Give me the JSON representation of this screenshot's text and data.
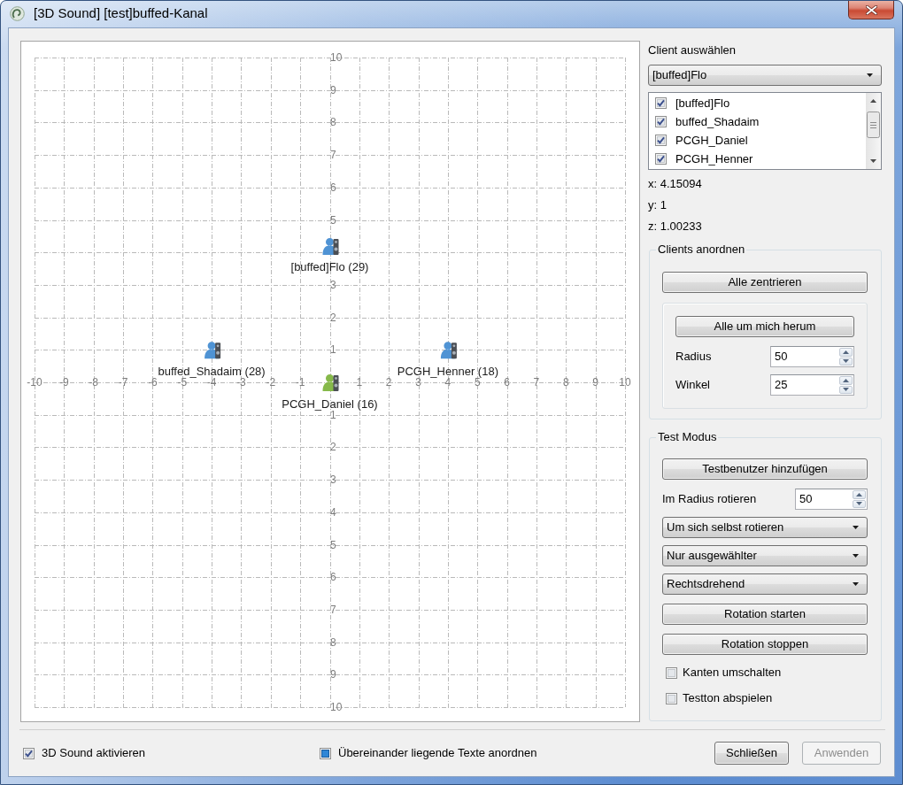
{
  "window": {
    "title": "[3D Sound] [test]buffed-Kanal"
  },
  "canvas": {
    "chart_data": {
      "type": "scatter",
      "grid": true,
      "xlim": [
        -10,
        10
      ],
      "ylim": [
        -10,
        10
      ],
      "xticks": [
        -10,
        -9,
        -8,
        -7,
        -6,
        -5,
        -4,
        -3,
        -2,
        -1,
        1,
        2,
        3,
        4,
        5,
        6,
        7,
        8,
        9,
        10
      ],
      "yticks": [
        10,
        9,
        8,
        7,
        6,
        5,
        3,
        2,
        1,
        {
          "value": -1,
          "label": "1"
        },
        {
          "value": -2,
          "label": "2"
        },
        {
          "value": -3,
          "label": "3"
        },
        {
          "value": -4,
          "label": "4"
        },
        {
          "value": -5,
          "label": "5"
        },
        {
          "value": -6,
          "label": "6"
        },
        {
          "value": -7,
          "label": "7"
        },
        {
          "value": -8,
          "label": "8"
        },
        {
          "value": -9,
          "label": "9"
        },
        {
          "value": -10,
          "label": "10"
        }
      ],
      "x": [
        -4,
        0,
        4
      ],
      "series": [
        {
          "name": "[buffed]Flo (29)",
          "color": "#4f93d4",
          "values": [
            null,
            4.2,
            null
          ]
        },
        {
          "name": "buffed_Shadaim (28)",
          "color": "#4f93d4",
          "values": [
            1,
            null,
            null
          ]
        },
        {
          "name": "PCGH_Henner (18)",
          "color": "#4f93d4",
          "values": [
            null,
            null,
            1
          ]
        },
        {
          "name": "PCGH_Daniel (16)",
          "color": "#86b94a",
          "values": [
            null,
            0,
            null
          ]
        }
      ]
    }
  },
  "client_panel": {
    "title": "Client auswählen",
    "selected_client": "[buffed]Flo",
    "clients": [
      {
        "name": "[buffed]Flo",
        "checked": true
      },
      {
        "name": "buffed_Shadaim",
        "checked": true
      },
      {
        "name": "PCGH_Daniel",
        "checked": true
      },
      {
        "name": "PCGH_Henner",
        "checked": true
      }
    ],
    "coordinates": [
      "x: 4.15094",
      "y: 1",
      "z: 1.00233"
    ]
  },
  "arrange_group": {
    "title": "Clients anordnen",
    "center_all_button": "Alle zentrieren",
    "around_me": {
      "button": "Alle um mich herum",
      "fields": [
        {
          "label": "Radius",
          "value": "50"
        },
        {
          "label": "Winkel",
          "value": "25"
        }
      ]
    }
  },
  "test_group": {
    "title": "Test Modus",
    "items": [
      {
        "kind": "button",
        "label": "Testbenutzer hinzufügen"
      },
      {
        "kind": "spin",
        "label": "Im Radius rotieren",
        "value": "50"
      },
      {
        "kind": "select",
        "value": "Um sich selbst rotieren"
      },
      {
        "kind": "select",
        "value": "Nur ausgewählter"
      },
      {
        "kind": "select",
        "value": "Rechtsdrehend"
      },
      {
        "kind": "button",
        "label": "Rotation starten"
      },
      {
        "kind": "button",
        "label": "Rotation stoppen"
      },
      {
        "kind": "checkbox",
        "label": "Kanten umschalten",
        "checked": false
      },
      {
        "kind": "checkbox",
        "label": "Testton abspielen",
        "checked": false
      }
    ]
  },
  "footer": {
    "options": [
      {
        "label": "3D Sound aktivieren",
        "checked": true,
        "indeterminate": false
      },
      {
        "label": "Übereinander liegende Texte anordnen",
        "checked": true,
        "indeterminate": true
      }
    ],
    "buttons": [
      {
        "label": "Schließen",
        "disabled": false
      },
      {
        "label": "Anwenden",
        "disabled": true
      }
    ]
  }
}
